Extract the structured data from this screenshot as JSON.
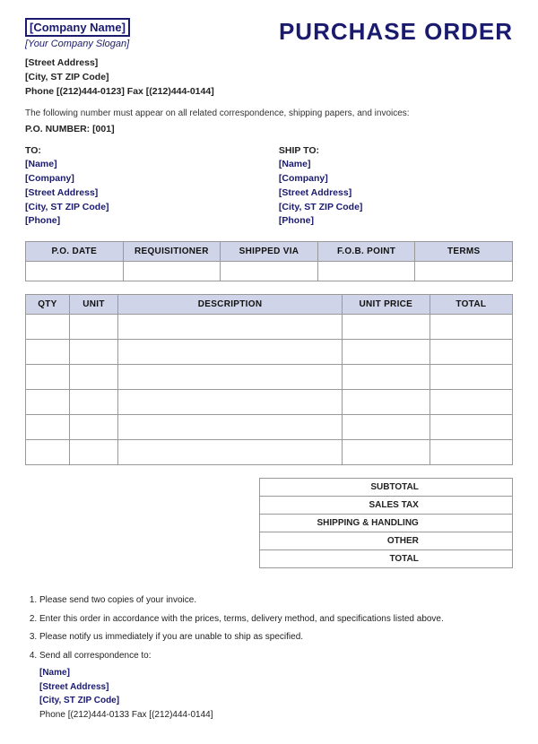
{
  "header": {
    "company_name": "[Company Name]",
    "company_slogan": "[Your Company Slogan]",
    "street_address": "[Street Address]",
    "city_st_zip": "[City, ST  ZIP Code]",
    "phone_fax": "Phone [(212)444-0123]   Fax [(212)444-0144]",
    "title": "PURCHASE ORDER"
  },
  "notice": {
    "text": "The following number must appear on all related correspondence, shipping papers, and invoices:",
    "po_number_label": "P.O. NUMBER: [001]"
  },
  "to": {
    "label": "TO:",
    "name": "[Name]",
    "company": "[Company]",
    "street": "[Street Address]",
    "city": "[City, ST  ZIP Code]",
    "phone": "[Phone]"
  },
  "ship_to": {
    "label": "SHIP TO:",
    "name": "[Name]",
    "company": "[Company]",
    "street": "[Street Address]",
    "city": "[City, ST  ZIP Code]",
    "phone": "[Phone]"
  },
  "po_info": {
    "columns": [
      "P.O. DATE",
      "REQUISITIONER",
      "SHIPPED VIA",
      "F.O.B. POINT",
      "TERMS"
    ]
  },
  "items": {
    "columns": [
      "QTY",
      "UNIT",
      "DESCRIPTION",
      "UNIT PRICE",
      "TOTAL"
    ],
    "rows": 6
  },
  "summary": {
    "rows": [
      {
        "label": "SUBTOTAL",
        "value": ""
      },
      {
        "label": "SALES TAX",
        "value": ""
      },
      {
        "label": "SHIPPING & HANDLING",
        "value": ""
      },
      {
        "label": "OTHER",
        "value": ""
      },
      {
        "label": "TOTAL",
        "value": ""
      }
    ]
  },
  "footer": {
    "notes": [
      "Please send two copies of your invoice.",
      "Enter this order in accordance with the prices, terms, delivery method, and specifications  listed above.",
      "Please notify us immediately if you are unable to ship as specified.",
      "Send all correspondence to:"
    ],
    "contact_name": "[Name]",
    "contact_street": "[Street Address]",
    "contact_city": "[City, ST  ZIP Code]",
    "contact_phone_fax": "Phone [(212)444-0133    Fax [(212)444-0144]"
  }
}
